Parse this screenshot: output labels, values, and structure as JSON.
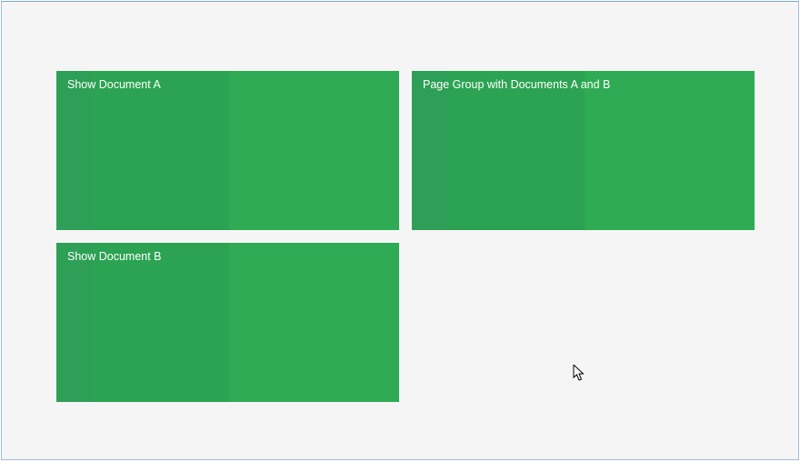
{
  "tiles": [
    {
      "label": "Show Document A"
    },
    {
      "label": "Page Group with Documents A and B"
    },
    {
      "label": "Show Document B"
    }
  ],
  "colors": {
    "stripe1": "#2e9f56",
    "stripe2": "#2ca352",
    "stripe3": "#2eab54",
    "panel_border": "#a3bde3",
    "panel_bg": "#f5f5f5"
  }
}
